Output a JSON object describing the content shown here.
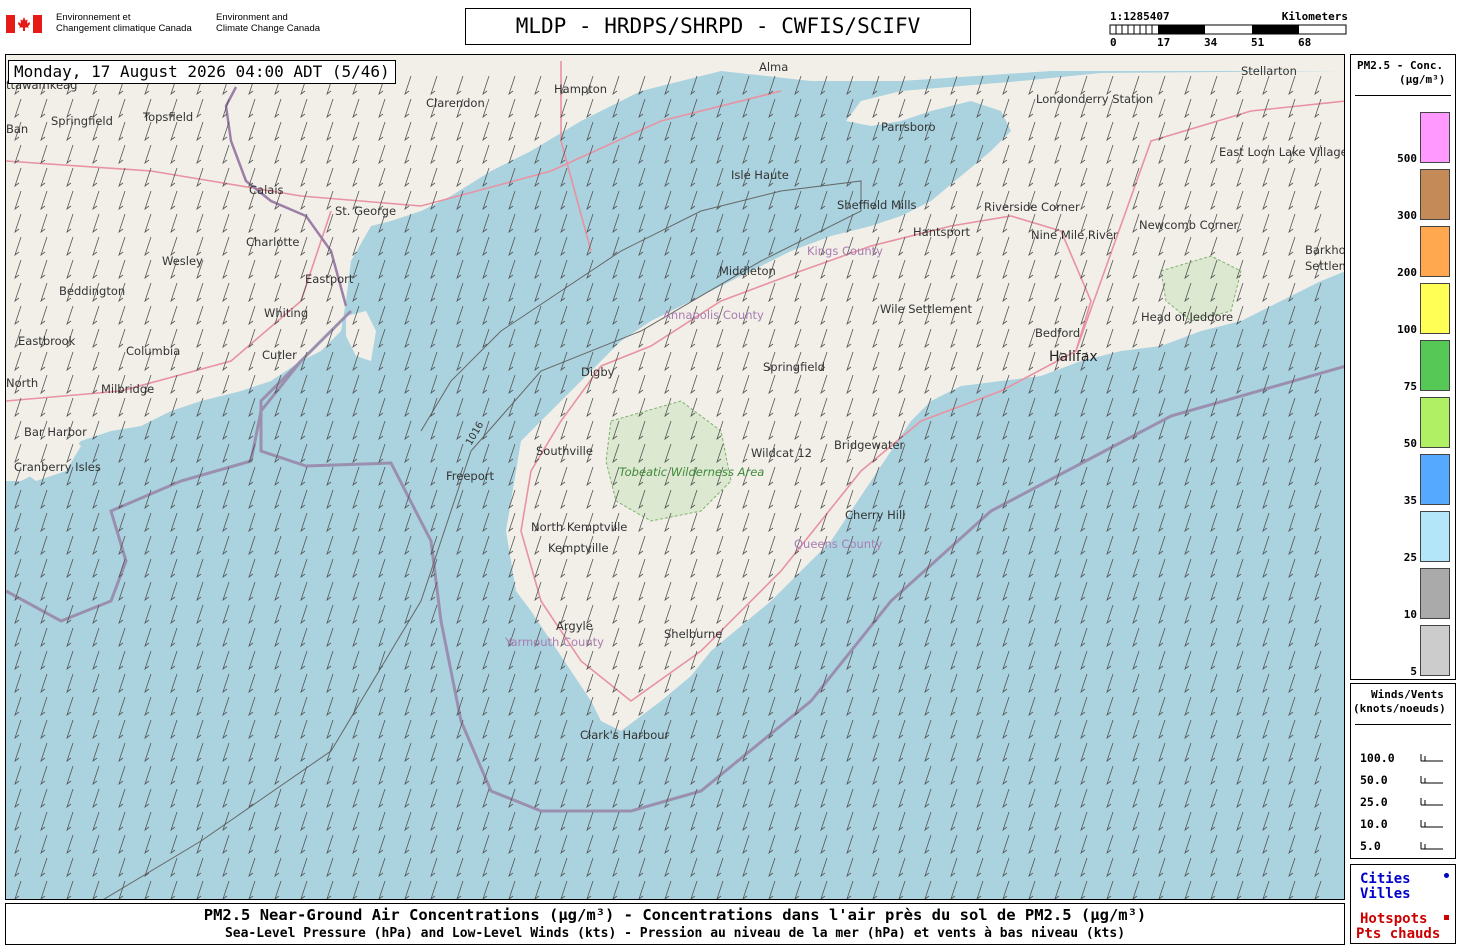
{
  "header": {
    "gov_fr": "Environnement et\nChangement climatique Canada",
    "gov_en": "Environment and\nClimate Change Canada",
    "title": "MLDP - HRDPS/SHRPD - CWFIS/SCIFV"
  },
  "scale": {
    "ratio": "1:1285407",
    "unit": "Kilometers",
    "ticks": [
      "0",
      "17",
      "34",
      "51",
      "68"
    ]
  },
  "timestamp": "Monday, 17 August 2026 04:00 ADT (5/46)",
  "map": {
    "places": [
      "Alma",
      "Stellarton",
      "Hampton",
      "Clarendon",
      "Londonderry Station",
      "Parrsboro",
      "East Loon Lake Village",
      "Springfield",
      "Topsfield",
      "Isle Haute",
      "Calais",
      "St. George",
      "Sheffield Mills",
      "Riverside Corner",
      "Charlotte",
      "Hantsport",
      "Newcomb Corner",
      "Nine Mile River",
      "Wesley",
      "Eastport",
      "Middleton",
      "Kings County",
      "Barkho",
      "Settlem",
      "Beddington",
      "Whiting",
      "Wile Settlement",
      "Head of Jeddore",
      "Annapolis County",
      "Bedford",
      "Eastbrook",
      "Columbia",
      "Cutler",
      "Halifax",
      "Digby",
      "Springfield",
      "North",
      "Milbridge",
      "Bar Harbor",
      "Southville",
      "Wildcat 12",
      "Bridgewater",
      "Cranberry Isles",
      "Freeport",
      "Tobeatic Wilderness Area",
      "Cherry Hill",
      "North Kemptville",
      "Kemptville",
      "Queens County",
      "Argyle",
      "Shelburne",
      "Yarmouth County",
      "Clark's Harbour",
      "ttawamkeag",
      "Ban"
    ],
    "isobar_label": "1016"
  },
  "pm_legend": {
    "title": "PM2.5 - Conc.",
    "unit": "(µg/m³)",
    "levels": [
      {
        "value": "500",
        "color": "#ff99ff"
      },
      {
        "value": "300",
        "color": "#c48a58"
      },
      {
        "value": "200",
        "color": "#ffa850"
      },
      {
        "value": "100",
        "color": "#ffff55"
      },
      {
        "value": "75",
        "color": "#55c855"
      },
      {
        "value": "50",
        "color": "#aff065"
      },
      {
        "value": "35",
        "color": "#55aaff"
      },
      {
        "value": "25",
        "color": "#b4e6fa"
      },
      {
        "value": "10",
        "color": "#aaaaaa"
      },
      {
        "value": "5",
        "color": "#cccccc"
      }
    ]
  },
  "wind_legend": {
    "title1": "Winds/Vents",
    "title2": "(knots/noeuds)",
    "speeds": [
      "100.0",
      "50.0",
      "25.0",
      "10.0",
      "5.0"
    ]
  },
  "cities_legend": {
    "cities": "Cities",
    "villes": "Villes",
    "hotspots": "Hotspots",
    "pts_chauds": "Pts chauds",
    "cities_color": "#0000cc",
    "hotspots_color": "#cc0000"
  },
  "footer": {
    "line1": "PM2.5 Near-Ground Air Concentrations (µg/m³) - Concentrations dans l'air près du sol de PM2.5 (µg/m³)",
    "line2": "Sea-Level Pressure (hPa) and Low-Level Winds (kts) - Pression au niveau de la mer (hPa) et vents à bas niveau (kts)"
  }
}
